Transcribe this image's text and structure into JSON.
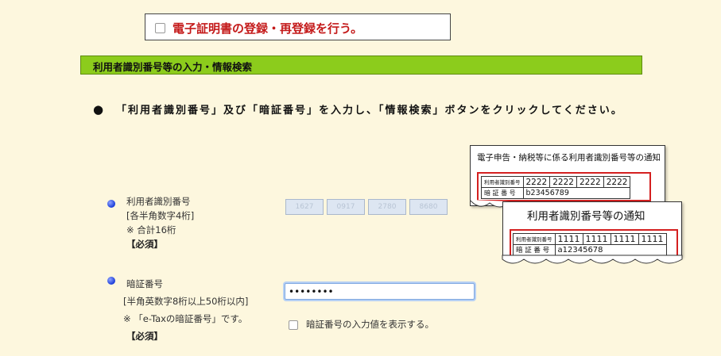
{
  "certificate": {
    "label": "電子証明書の登録・再登録を行う。"
  },
  "section": {
    "title": "利用者識別番号等の入力・情報検索"
  },
  "instruction": {
    "bullet": "●",
    "text": "「利用者識別番号」及び「暗証番号」を入力し、「情報検索」ボタンをクリックしてください。"
  },
  "user_id_field": {
    "label": "利用者識別番号",
    "hint1": "[各半角数字4桁]",
    "hint2": "※ 合計16桁",
    "required": "【必須】",
    "values": [
      "1627",
      "0917",
      "2780",
      "8680"
    ]
  },
  "password_field": {
    "label": "暗証番号",
    "hint1": "[半角英数字8桁以上50桁以内]",
    "hint2": "※ 「e-Taxの暗証番号」です。",
    "required": "【必須】",
    "value": "••••••••",
    "show_checkbox_label": "暗証番号の入力値を表示する。"
  },
  "notice_back": {
    "title": "電子申告・納税等に係る利用者識別番号等の通知",
    "id_label": "利用者識別番号",
    "pw_label": "暗 証 番 号",
    "id_values": [
      "2222",
      "2222",
      "2222",
      "2222"
    ],
    "pw_value": "b23456789"
  },
  "notice_front": {
    "title": "利用者識別番号等の通知",
    "id_label": "利用者識別番号",
    "pw_label": "暗 証 番 号",
    "id_values": [
      "1111",
      "1111",
      "1111",
      "1111"
    ],
    "pw_value": "a12345678"
  },
  "colors": {
    "background": "#fdf7de",
    "section_bar": "#8ccc1c",
    "certificate_text": "#c41a1a",
    "highlight_frame": "#d42020",
    "radio_dot": "#1a3cd8"
  }
}
